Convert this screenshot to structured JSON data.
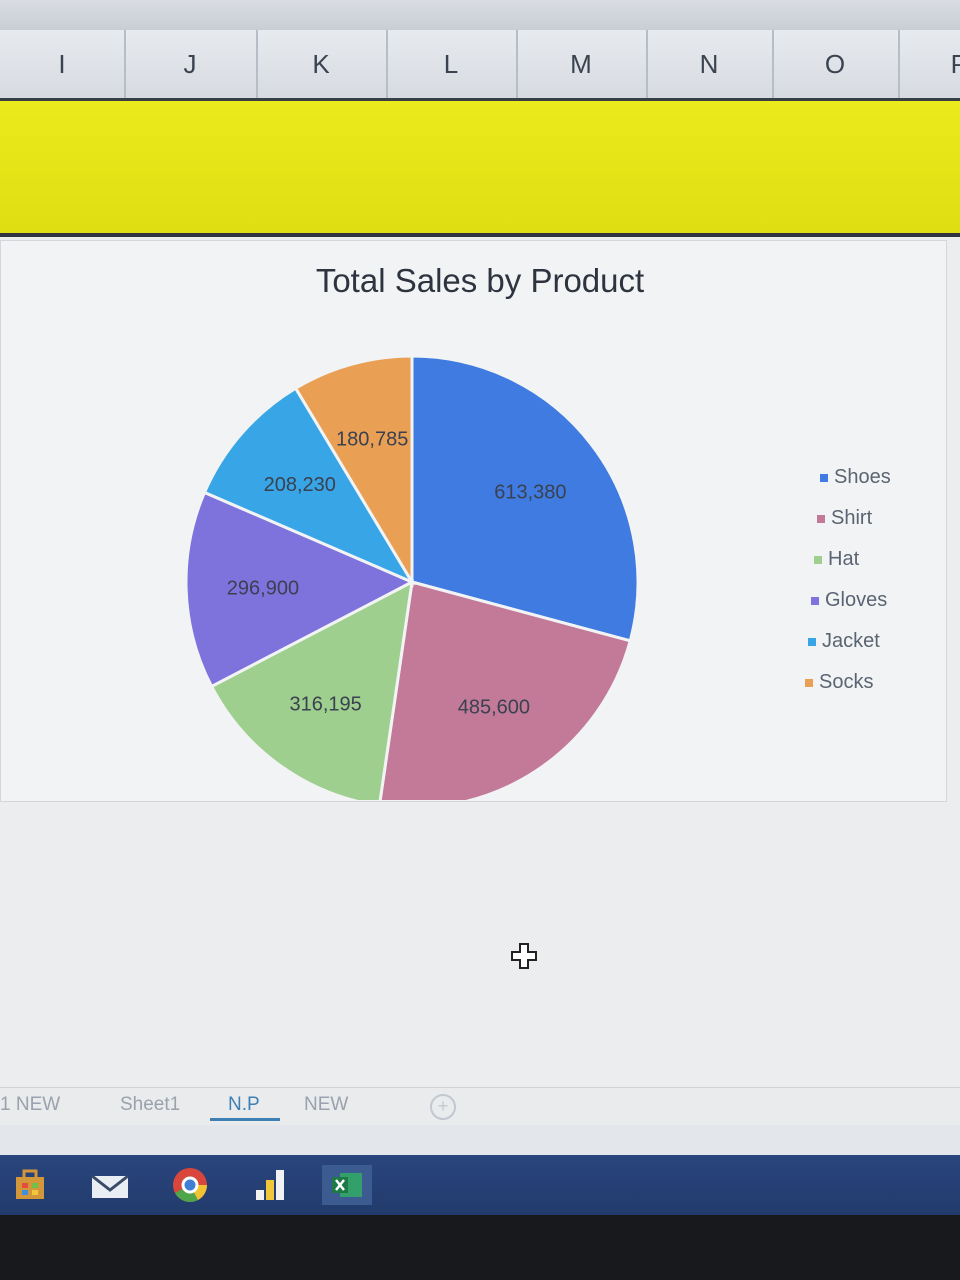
{
  "columns": [
    "I",
    "J",
    "K",
    "L",
    "M",
    "N",
    "O",
    "P"
  ],
  "chart_data": {
    "type": "pie",
    "title": "Total Sales by  Product",
    "categories": [
      "Shoes",
      "Shirt",
      "Hat",
      "Gloves",
      "Jacket",
      "Socks"
    ],
    "values": [
      613380,
      485600,
      316195,
      296900,
      208230,
      180785
    ],
    "value_labels": [
      "613,380",
      "485,600",
      "316,195",
      "296,900",
      "208,230",
      "180,785"
    ],
    "colors": [
      "#3f7be0",
      "#c27a98",
      "#9fcf8e",
      "#7e72dd",
      "#38a6e6",
      "#e9a054"
    ],
    "legend_position": "right"
  },
  "sheet_tabs": [
    {
      "label": "1 NEW",
      "active": false
    },
    {
      "label": "Sheet1",
      "active": false
    },
    {
      "label": "N.P",
      "active": true
    },
    {
      "label": "NEW",
      "active": false
    }
  ],
  "taskbar": [
    "store-icon",
    "mail-icon",
    "chrome-icon",
    "chart-app-icon",
    "excel-icon"
  ],
  "cursor": "move-cross-icon"
}
